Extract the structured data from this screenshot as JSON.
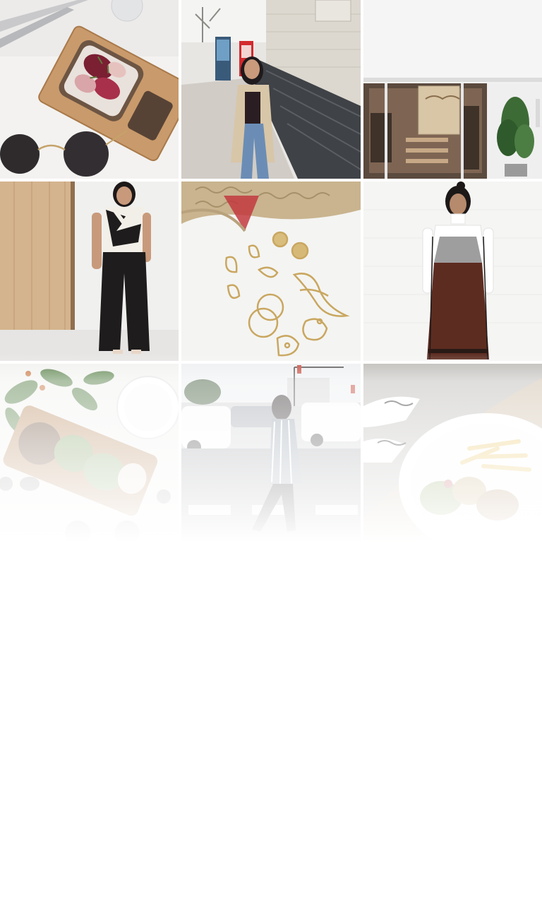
{
  "feed": {
    "tiles": [
      {
        "name": "tile-toast-sunglasses",
        "icon": "photo-food-flatlay"
      },
      {
        "name": "tile-street-fashion-london",
        "icon": "photo-portrait-street"
      },
      {
        "name": "tile-storefront",
        "icon": "photo-storefront"
      },
      {
        "name": "tile-jumpsuit-outfit",
        "icon": "photo-portrait-indoor"
      },
      {
        "name": "tile-earrings-flatlay",
        "icon": "photo-jewelry-flatlay"
      },
      {
        "name": "tile-slip-dress-outfit",
        "icon": "photo-portrait-indoor"
      },
      {
        "name": "tile-brunch-flatlay",
        "icon": "photo-food-flatlay"
      },
      {
        "name": "tile-crosswalk-outfit",
        "icon": "photo-portrait-street"
      },
      {
        "name": "tile-fries-plate",
        "icon": "photo-food-plate"
      }
    ],
    "colors": {
      "background": "#ffffff",
      "fade": "#ffffff"
    }
  }
}
